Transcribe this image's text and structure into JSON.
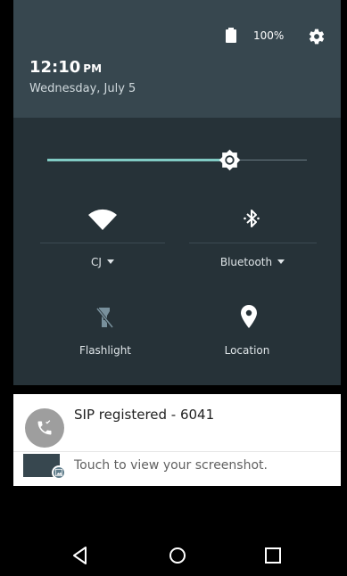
{
  "status": {
    "battery_percent": "100%"
  },
  "header": {
    "time": "12:10",
    "ampm": "PM",
    "date": "Wednesday, July 5"
  },
  "brightness": {
    "level": 0.7
  },
  "tiles": [
    {
      "label": "CJ",
      "icon": "wifi-icon",
      "has_dropdown": true
    },
    {
      "label": "Bluetooth",
      "icon": "bluetooth-icon",
      "has_dropdown": true
    },
    {
      "label": "Flashlight",
      "icon": "flashlight-off-icon",
      "has_dropdown": false
    },
    {
      "label": "Location",
      "icon": "location-icon",
      "has_dropdown": false
    }
  ],
  "notifications": [
    {
      "title": "SIP registered - 6041",
      "icon": "phone-call-icon"
    },
    {
      "text": "Touch to view your screenshot.",
      "icon": "image-icon"
    }
  ],
  "nav": {
    "buttons": [
      "back-icon",
      "home-icon",
      "recents-icon"
    ]
  },
  "colors": {
    "header": "#37474F",
    "panel": "#263238",
    "accent": "#80CBC4"
  }
}
